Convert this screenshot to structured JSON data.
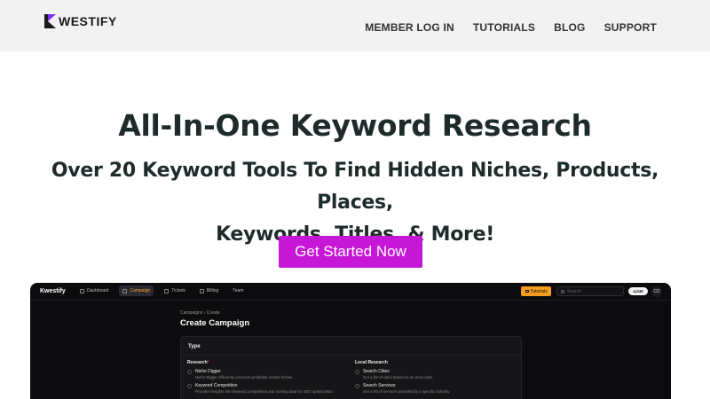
{
  "header": {
    "brand": "WESTIFY",
    "nav": [
      "MEMBER LOG IN",
      "TUTORIALS",
      "BLOG",
      "SUPPORT"
    ]
  },
  "hero": {
    "title": "All-In-One Keyword Research",
    "subtitle_line1": "Over 20 Keyword Tools To Find Hidden Niches, Products, Places,",
    "subtitle_line2": "Keywords, Titles, & More!",
    "cta": "Get Started Now"
  },
  "colors": {
    "cta_bg": "#c617d6",
    "brand_purple": "#7b2ff7",
    "preview_bg": "#0c0c0e",
    "accent_orange": "#f39c21"
  },
  "app": {
    "brand": "Kwestify",
    "nav": [
      {
        "label": "Dashboard",
        "icon": "home-icon"
      },
      {
        "label": "Campaign",
        "icon": "list-icon"
      },
      {
        "label": "Tickets",
        "icon": "ticket-icon"
      },
      {
        "label": "Billing",
        "icon": "card-icon"
      },
      {
        "label": "Team",
        "icon": ""
      }
    ],
    "tutorials": "Tutorials",
    "search_placeholder": "Search",
    "credits": "4,040",
    "avatar": "CD",
    "breadcrumb": "Campaigns  ›  Create",
    "page_title": "Create Campaign",
    "panel_title": "Type",
    "research": {
      "heading": "Research",
      "required_mark": "*",
      "options": [
        {
          "title": "Niche Digger",
          "desc": "Niche Digger efficiently uncovers profitable market niches."
        },
        {
          "title": "Keyword Competition",
          "desc": "Provides insights into keyword competition and ranking data for SEO optimization."
        }
      ]
    },
    "local_research": {
      "heading": "Local Research",
      "options": [
        {
          "title": "Search Cities",
          "desc": "Get a list of cities based on an area code."
        },
        {
          "title": "Search Services",
          "desc": "Get a list of services provided by a specific industry."
        }
      ]
    }
  }
}
